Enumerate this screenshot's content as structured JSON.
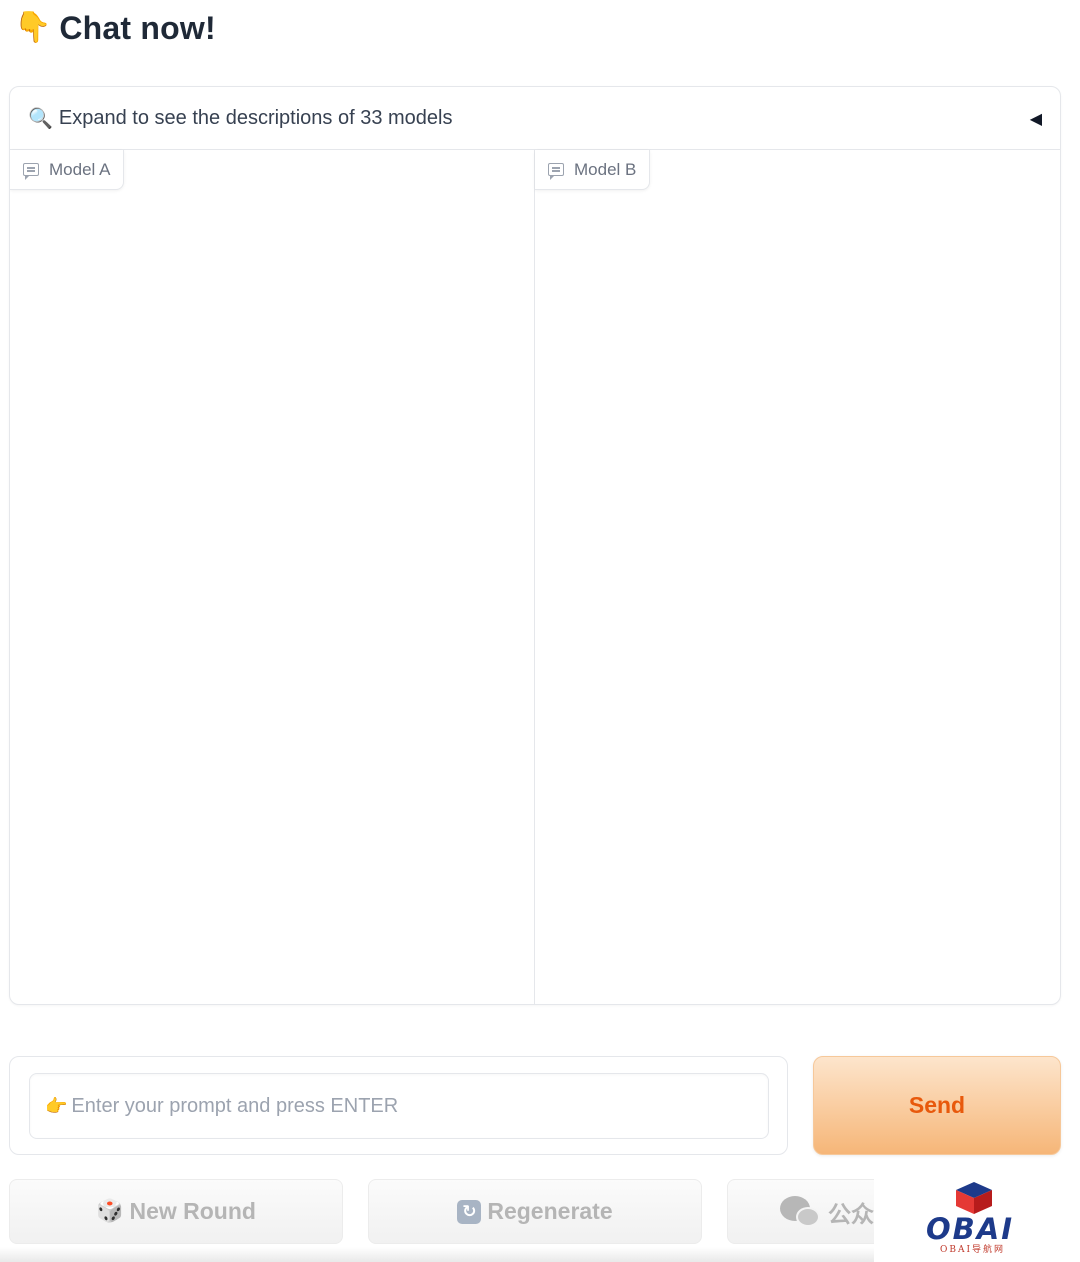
{
  "header": {
    "title": "Chat now!",
    "title_icon": "pointing-down-hand-emoji"
  },
  "accordion": {
    "icon": "magnifier-icon",
    "label": "Expand to see the descriptions of 33 models",
    "caret": "◀"
  },
  "chatbots": [
    {
      "label": "Model A",
      "icon": "chat-bubble-icon"
    },
    {
      "label": "Model B",
      "icon": "chat-bubble-icon"
    }
  ],
  "input": {
    "icon": "pointing-right-hand-emoji",
    "placeholder": "Enter your prompt and press ENTER",
    "value": ""
  },
  "send_button": {
    "label": "Send",
    "colors": {
      "text": "#e8590c",
      "gradient_top": "#fde5cc",
      "gradient_bottom": "#f6b678"
    }
  },
  "actions": {
    "new_round": {
      "label": "New Round",
      "icon": "dice-icon"
    },
    "regenerate": {
      "label": "Regenerate",
      "icon": "refresh-icon"
    },
    "third": {
      "label": "公众",
      "icon": "wechat-icon"
    }
  },
  "watermark": {
    "brand": "OBAI",
    "sub": "OBAI导航网"
  }
}
